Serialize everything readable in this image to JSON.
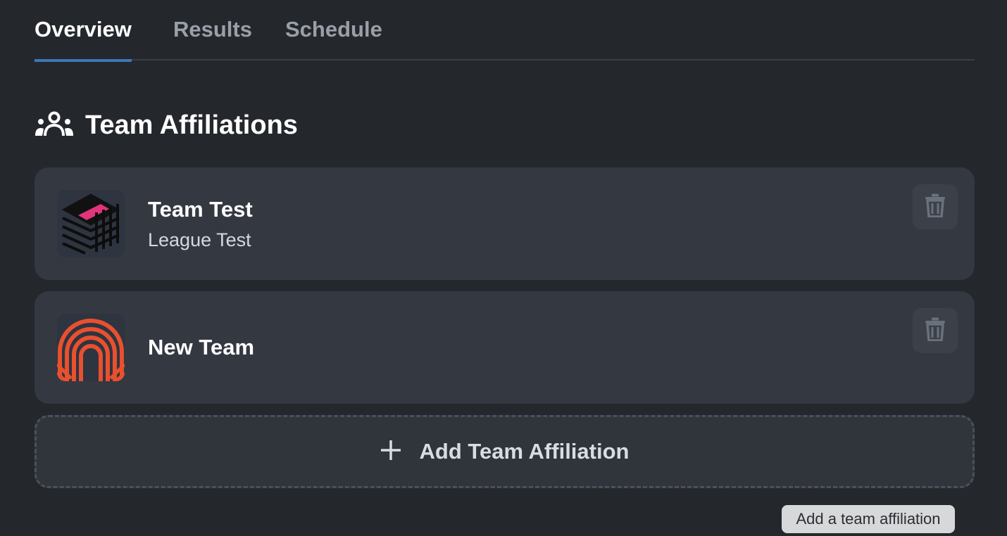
{
  "tabs": [
    {
      "label": "Overview",
      "active": true
    },
    {
      "label": "Results",
      "active": false
    },
    {
      "label": "Schedule",
      "active": false
    }
  ],
  "section": {
    "icon": "users-group-icon",
    "title": "Team Affiliations"
  },
  "affiliations": [
    {
      "team": "Team Test",
      "league": "League Test",
      "logo": "stacked-box-logo"
    },
    {
      "team": "New Team",
      "league": "",
      "logo": "orange-arches-logo"
    }
  ],
  "add_button": {
    "icon": "plus-icon",
    "label": "Add Team Affiliation"
  },
  "tooltip": {
    "text": "Add a team affiliation"
  },
  "colors": {
    "background": "#24272c",
    "card": "#343841",
    "accent": "#3b78b8",
    "logo_orange": "#e8502e",
    "logo_pink": "#e0357a"
  }
}
